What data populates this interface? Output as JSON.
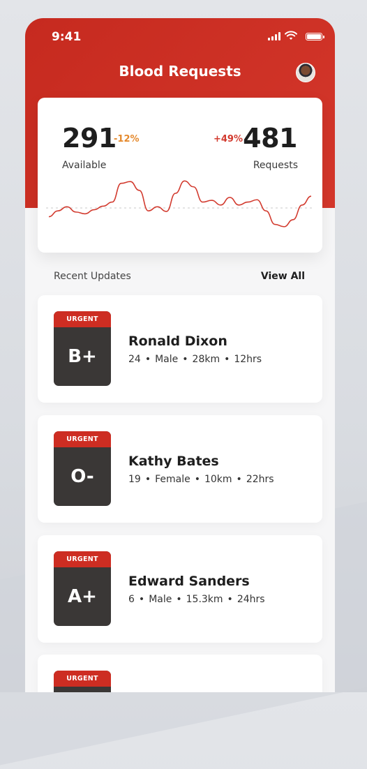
{
  "status_bar": {
    "time": "9:41"
  },
  "header": {
    "title": "Blood Requests"
  },
  "stats": {
    "available": "291",
    "available_change": "-12%",
    "available_label": "Available",
    "requests": "481",
    "requests_change": "+49%",
    "requests_label": "Requests"
  },
  "chart_data": {
    "type": "line",
    "color": "#d23a2e",
    "baseline": 0.5,
    "values": [
      0.35,
      0.45,
      0.52,
      0.43,
      0.4,
      0.47,
      0.53,
      0.6,
      0.92,
      0.95,
      0.8,
      0.45,
      0.52,
      0.44,
      0.75,
      0.96,
      0.86,
      0.6,
      0.63,
      0.55,
      0.68,
      0.55,
      0.6,
      0.64,
      0.45,
      0.22,
      0.18,
      0.3,
      0.55,
      0.7
    ]
  },
  "recent": {
    "title": "Recent Updates",
    "view_all": "View All"
  },
  "requests_list": [
    {
      "tag": "URGENT",
      "type": "B+",
      "name": "Ronald Dixon",
      "age": "24",
      "gender": "Male",
      "distance": "28km",
      "time": "12hrs"
    },
    {
      "tag": "URGENT",
      "type": "O-",
      "name": "Kathy Bates",
      "age": "19",
      "gender": "Female",
      "distance": "10km",
      "time": "22hrs"
    },
    {
      "tag": "URGENT",
      "type": "A+",
      "name": "Edward Sanders",
      "age": "6",
      "gender": "Male",
      "distance": "15.3km",
      "time": "24hrs"
    },
    {
      "tag": "URGENT",
      "type": "",
      "name": "",
      "age": "",
      "gender": "",
      "distance": "",
      "time": ""
    }
  ],
  "icons": {
    "signal": "cellular-signal-icon",
    "wifi": "wifi-icon",
    "battery": "battery-icon",
    "avatar": "user-avatar"
  }
}
